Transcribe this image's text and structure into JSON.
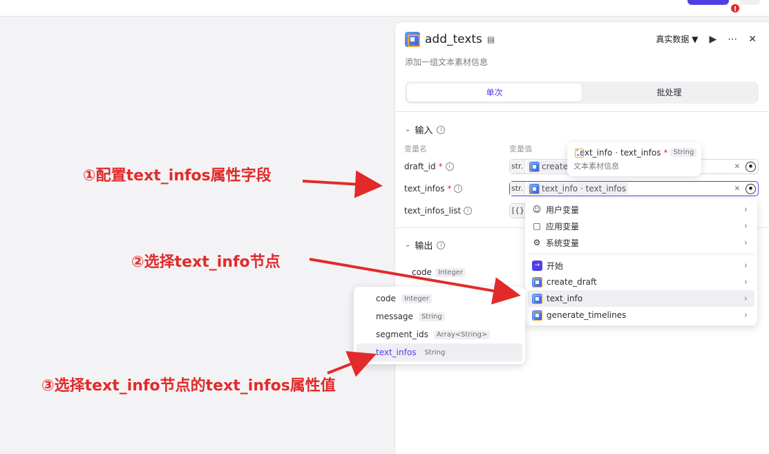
{
  "topbar": {
    "badge": "!"
  },
  "panel": {
    "title": "add_texts",
    "subtitle": "添加一组文本素材信息",
    "mode": "真实数据",
    "tabs": [
      "单次",
      "批处理"
    ],
    "input_section": "输入",
    "col_name": "变量名",
    "col_value": "变量值",
    "rows": [
      {
        "name": "draft_id",
        "required": true,
        "type": "str.",
        "ref": "create_"
      },
      {
        "name": "text_infos",
        "required": true,
        "type": "str.",
        "ref": "text_info · text_infos"
      },
      {
        "name": "text_infos_list",
        "required": false,
        "type": "[{}]",
        "ref": ""
      }
    ],
    "output_section": "输出",
    "outputs": [
      {
        "name": "code",
        "type": "Integer"
      }
    ]
  },
  "tooltip": {
    "node": "text_info",
    "sep": " · ",
    "field": "text_infos",
    "required": "*",
    "type": "String",
    "desc": "文本素材信息"
  },
  "dropdown": {
    "groups": [
      "用户变量",
      "应用变量",
      "系统变量"
    ],
    "nodes": [
      "开始",
      "create_draft",
      "text_info",
      "generate_timelines"
    ]
  },
  "sublist": [
    {
      "name": "code",
      "type": "Integer"
    },
    {
      "name": "message",
      "type": "String"
    },
    {
      "name": "segment_ids",
      "type": "Array<String>"
    },
    {
      "name": "text_infos",
      "type": "String"
    }
  ],
  "annotations": {
    "step1": "①配置text_infos属性字段",
    "step2": "②选择text_info节点",
    "step3": "③选择text_info节点的text_infos属性值"
  },
  "colors": {
    "accent": "#4e40e5",
    "annotation": "#e22a2a"
  }
}
